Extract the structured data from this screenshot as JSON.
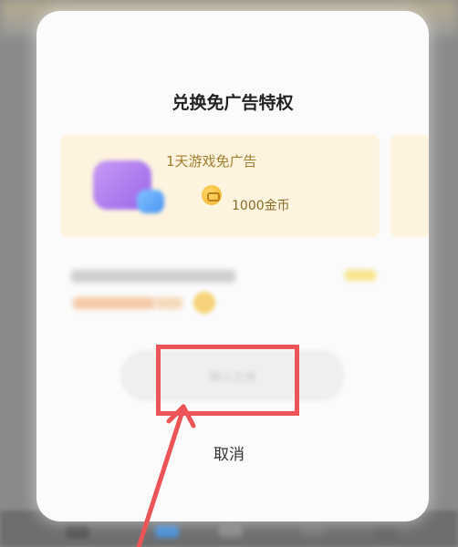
{
  "dialog": {
    "title": "兑换免广告特权",
    "cancel_label": "取消",
    "confirm_label": "确认兑换"
  },
  "reward_card": {
    "name": "1天游戏免广告",
    "price": "1000金币",
    "icon": "gift-box-icon",
    "coin_icon": "coin-icon"
  },
  "colors": {
    "card_bg": "#fdf3df",
    "card_title": "#a47e2f",
    "annotation_red": "#ec5458"
  }
}
